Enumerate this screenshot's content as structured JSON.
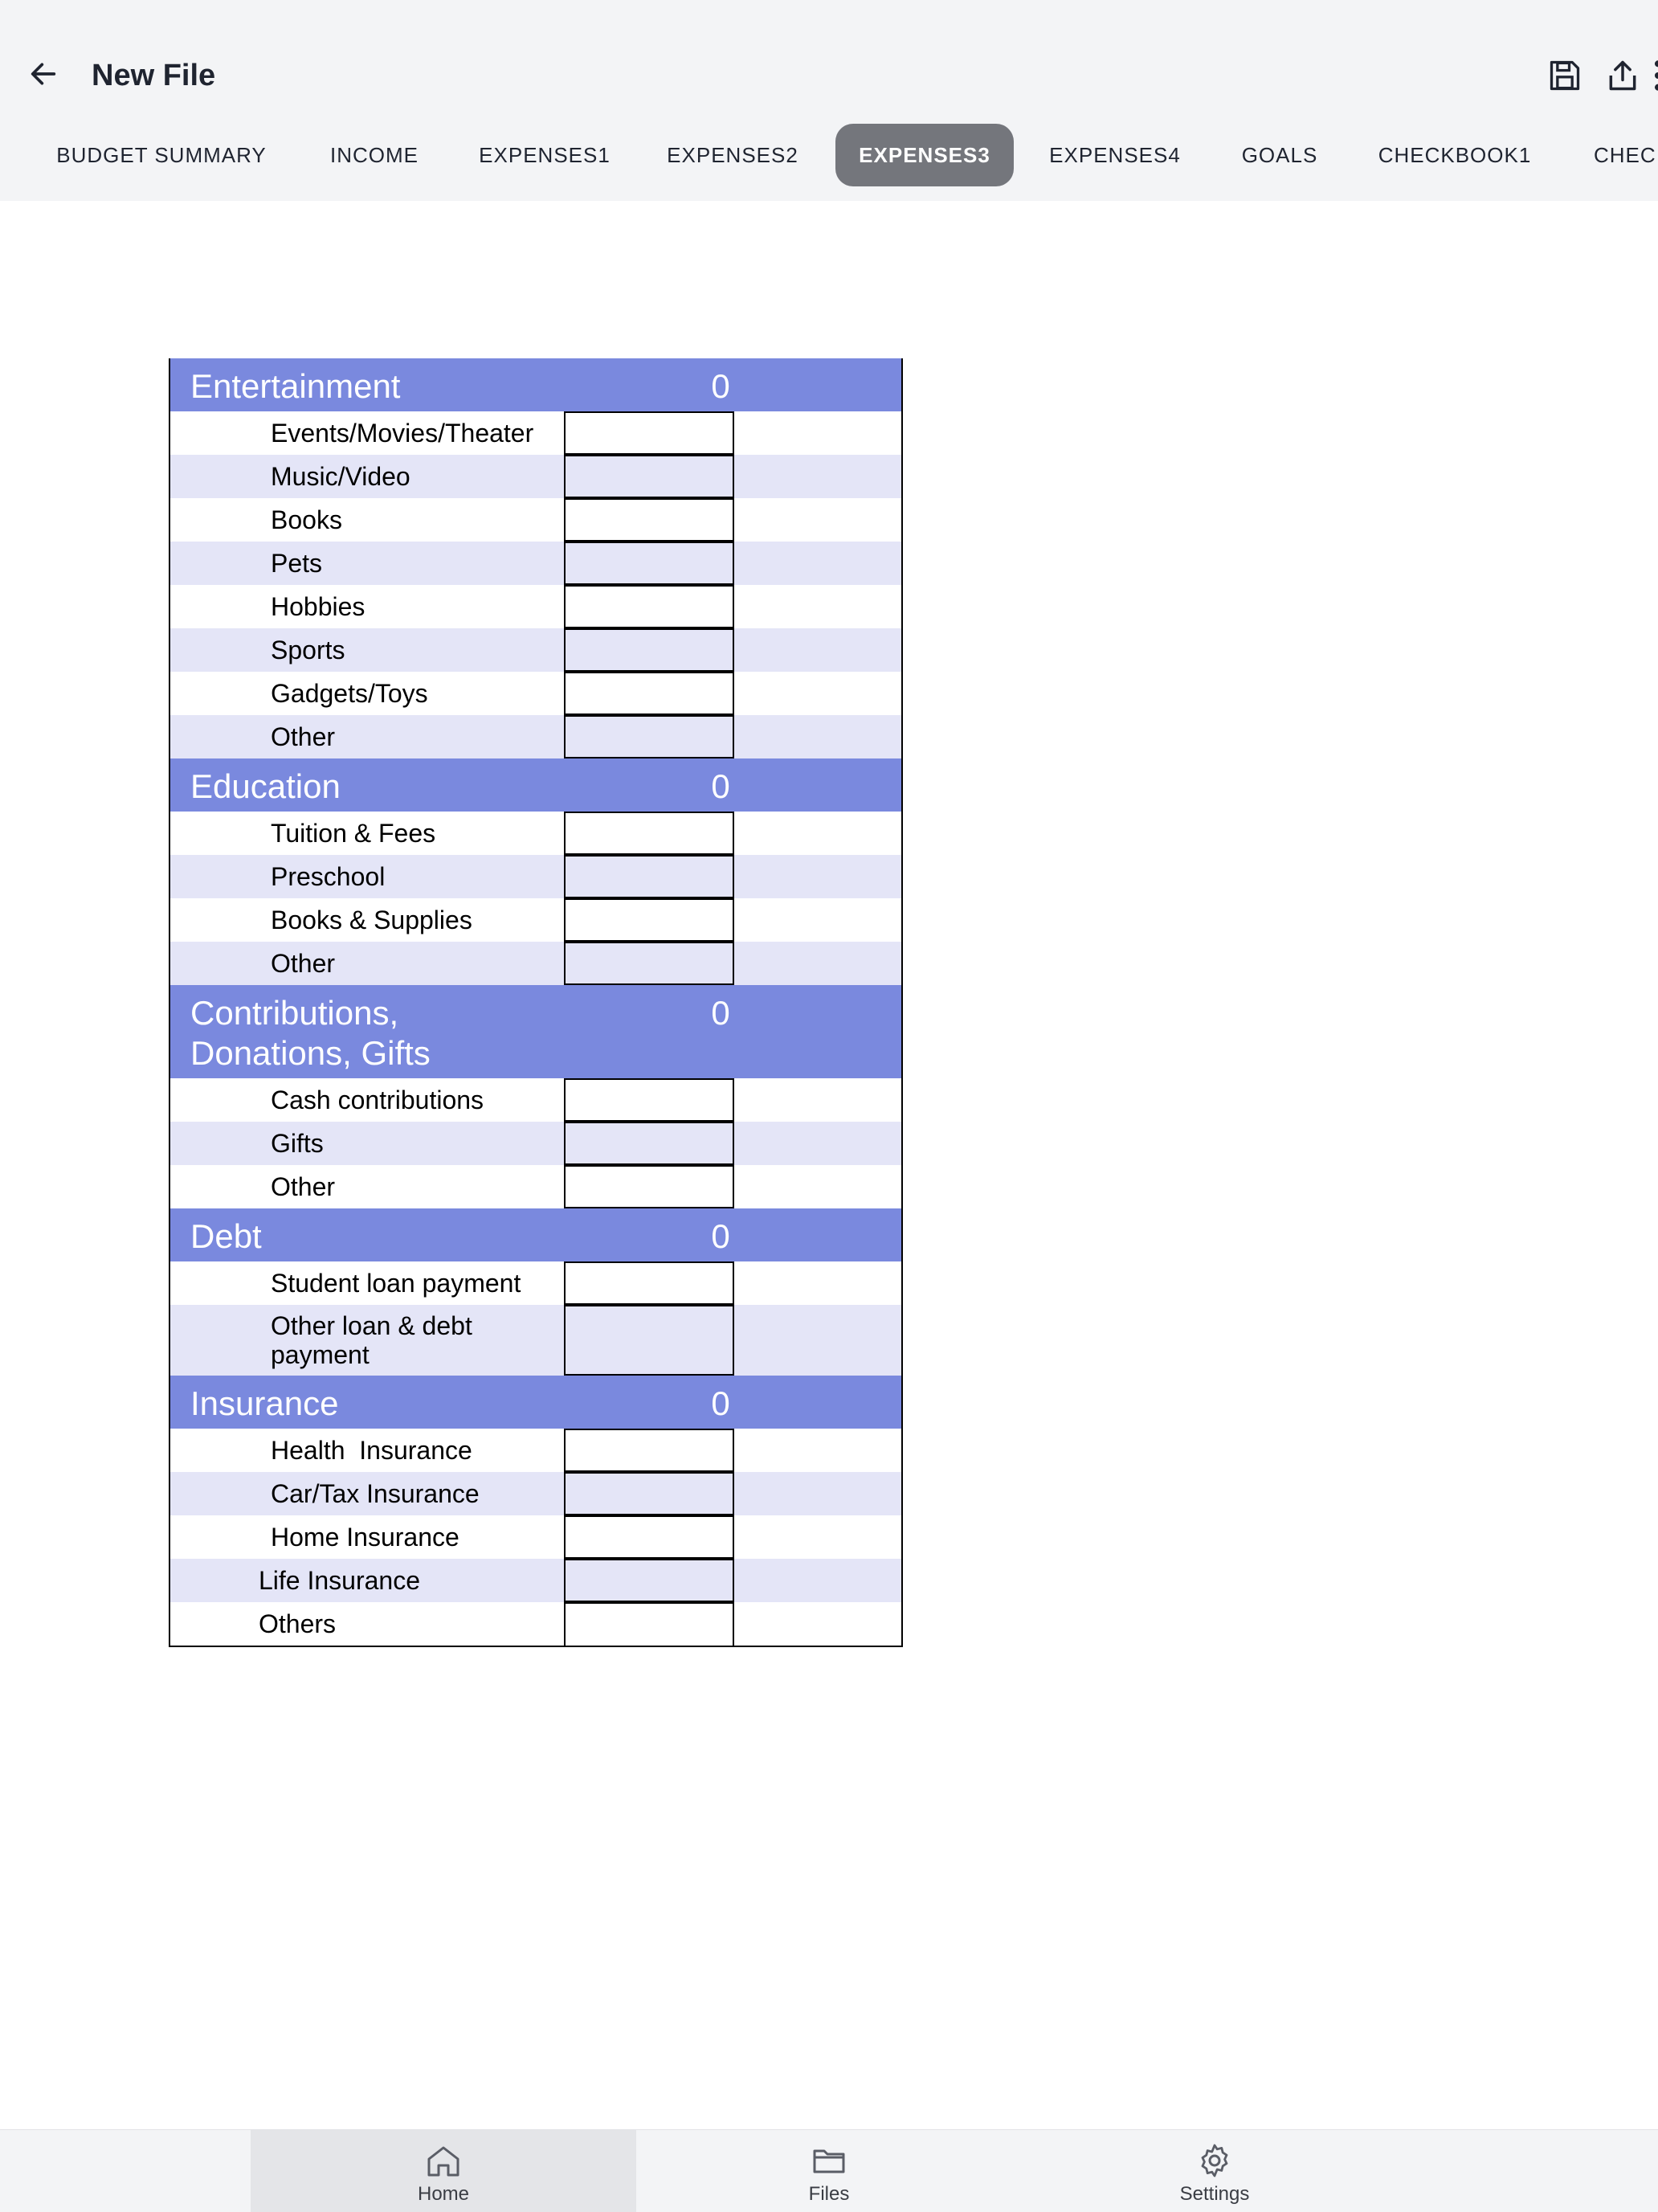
{
  "app": {
    "title": "New File"
  },
  "toolbar": {
    "save_icon": "save-icon",
    "share_icon": "share-icon",
    "more_icon": "more-vert-icon",
    "back_icon": "arrow-back-icon"
  },
  "tabs": [
    {
      "label": "BUDGET SUMMARY",
      "active": false
    },
    {
      "label": "INCOME",
      "active": false
    },
    {
      "label": "EXPENSES1",
      "active": false
    },
    {
      "label": "EXPENSES2",
      "active": false
    },
    {
      "label": "EXPENSES3",
      "active": true
    },
    {
      "label": "EXPENSES4",
      "active": false
    },
    {
      "label": "GOALS",
      "active": false
    },
    {
      "label": "CHECKBOOK1",
      "active": false
    },
    {
      "label": "CHEC",
      "active": false
    }
  ],
  "sections": [
    {
      "name": "Entertainment",
      "total": "0",
      "items": [
        "Events/Movies/Theater",
        "Music/Video",
        "Books",
        "Pets",
        "Hobbies",
        "Sports",
        "Gadgets/Toys",
        "Other"
      ]
    },
    {
      "name": "Education",
      "total": "0",
      "items": [
        "Tuition & Fees",
        "Preschool",
        "Books & Supplies",
        "Other"
      ]
    },
    {
      "name": "Contributions, Donations, Gifts",
      "total": "0",
      "items": [
        "Cash contributions",
        "Gifts",
        "Other"
      ]
    },
    {
      "name": "Debt",
      "total": "0",
      "items": [
        "Student loan payment",
        "Other loan & debt payment"
      ]
    },
    {
      "name": "Insurance",
      "total": "0",
      "items": [
        "Health  Insurance",
        "Car/Tax Insurance",
        "Home Insurance",
        "Life Insurance",
        "Others"
      ]
    }
  ],
  "bottom_nav": [
    {
      "label": "Home",
      "icon": "home-icon",
      "active": true
    },
    {
      "label": "Files",
      "icon": "folder-icon",
      "active": false
    },
    {
      "label": "Settings",
      "icon": "gear-icon",
      "active": false
    }
  ],
  "colors": {
    "header_bg": "#7a89de",
    "alt_row": "#e4e5f7",
    "active_tab": "#74767c"
  }
}
